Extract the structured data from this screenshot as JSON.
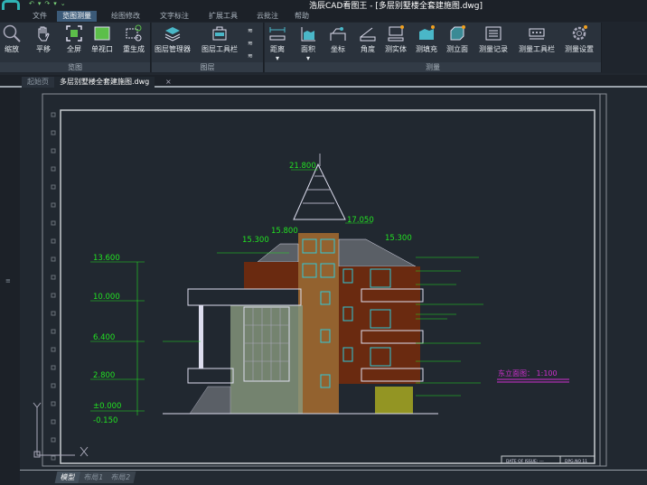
{
  "app": {
    "title": "浩辰CAD看图王 - [多层别墅楼全套建施图.dwg]"
  },
  "menu": {
    "tabs": [
      "文件",
      "览图测量",
      "绘图修改",
      "文字标注",
      "扩展工具",
      "云批注",
      "帮助"
    ],
    "active": "览图测量"
  },
  "ribbon": {
    "groups": [
      {
        "label": "览图",
        "tools": [
          "缩放",
          "平移",
          "全屏",
          "单视口",
          "重生成"
        ]
      },
      {
        "label": "图层",
        "tools": [
          "图层管理器",
          "图层工具栏"
        ]
      },
      {
        "label": "测量",
        "tools": [
          "距离",
          "面积",
          "坐标",
          "角度",
          "测实体",
          "测填充",
          "测立面",
          "测量记录",
          "测量工具栏",
          "测量设置"
        ]
      }
    ]
  },
  "doc_tabs": [
    "起始页",
    "多层别墅楼全套建施图.dwg"
  ],
  "drawing": {
    "elevations_left": [
      "13.600",
      "10.000",
      "6.400",
      "2.800",
      "±0.000",
      "-0.150"
    ],
    "elevations_top": [
      "21.800",
      "17.050",
      "15.300",
      "15.800",
      "15.300"
    ],
    "caption": "东立面图： 1:100",
    "titleblock": [
      "DATE OF ISSUE: ---",
      "DPG.NO 11"
    ]
  },
  "layout_tabs": [
    "模型",
    "布局1",
    "布局2"
  ],
  "colors": {
    "accent": "#3b5a78",
    "dimension": "#22e022",
    "caption": "#d030d0"
  }
}
